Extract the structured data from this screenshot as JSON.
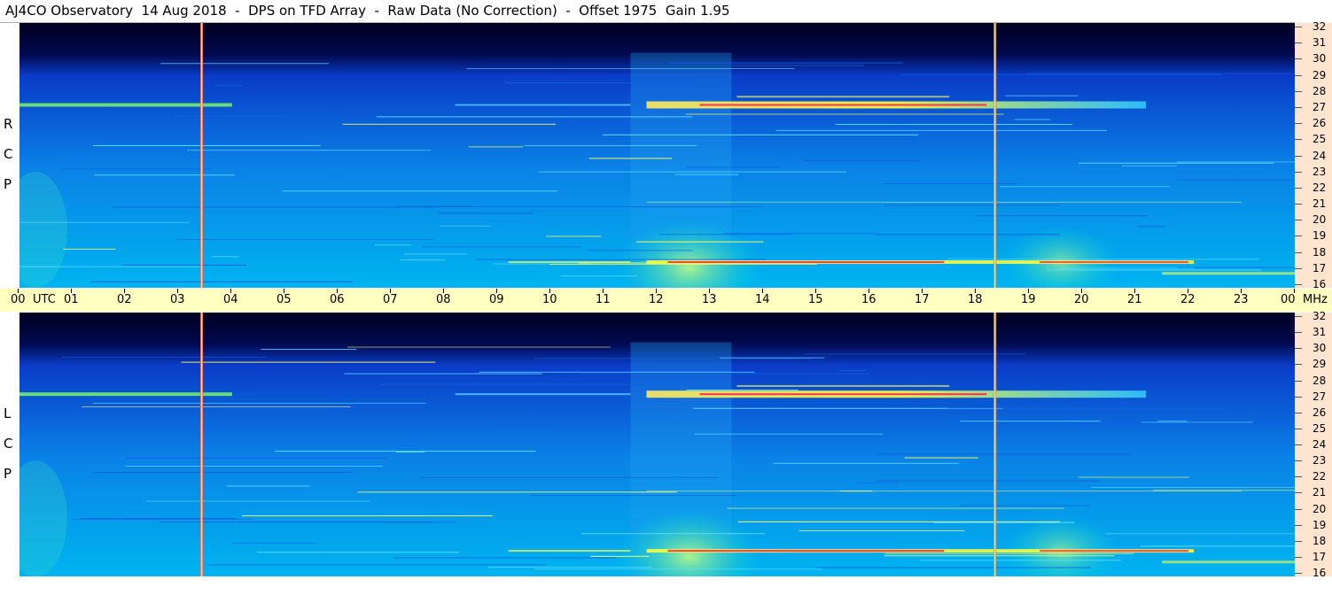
{
  "title": "AJ4CO Observatory  14 Aug 2018  -  DPS on TFD Array  -  Raw Data (No Correction)  -  Offset 1975  Gain 1.95",
  "panels": [
    {
      "id": "rcp",
      "letters": [
        "R",
        "C",
        "P"
      ]
    },
    {
      "id": "lcp",
      "letters": [
        "L",
        "C",
        "P"
      ]
    }
  ],
  "time_axis": {
    "labels": [
      "00",
      "01",
      "02",
      "03",
      "04",
      "05",
      "06",
      "07",
      "08",
      "09",
      "10",
      "11",
      "12",
      "13",
      "14",
      "15",
      "16",
      "17",
      "18",
      "19",
      "20",
      "21",
      "22",
      "23",
      "00"
    ],
    "utc_label": "UTC",
    "freq_unit_label": "MHz"
  },
  "freq_axis": {
    "labels": [
      "32",
      "31",
      "30",
      "29",
      "28",
      "27",
      "26",
      "25",
      "24",
      "23",
      "22",
      "21",
      "20",
      "19",
      "18",
      "17",
      "16"
    ]
  },
  "chart_data": {
    "type": "heatmap",
    "x_unit": "UTC hours",
    "x_range": [
      0,
      24
    ],
    "y_unit": "MHz",
    "y_range": [
      16,
      32
    ],
    "colors": {
      "background_high_freq": "#000020",
      "low_level": "#0a3cc8",
      "mid_level": "#00b4f0",
      "high_level": "#ffff30",
      "peak_level": "#ff2060",
      "time_bar": "#ffffc0",
      "freq_bar": "#ffe4d0"
    }
  }
}
